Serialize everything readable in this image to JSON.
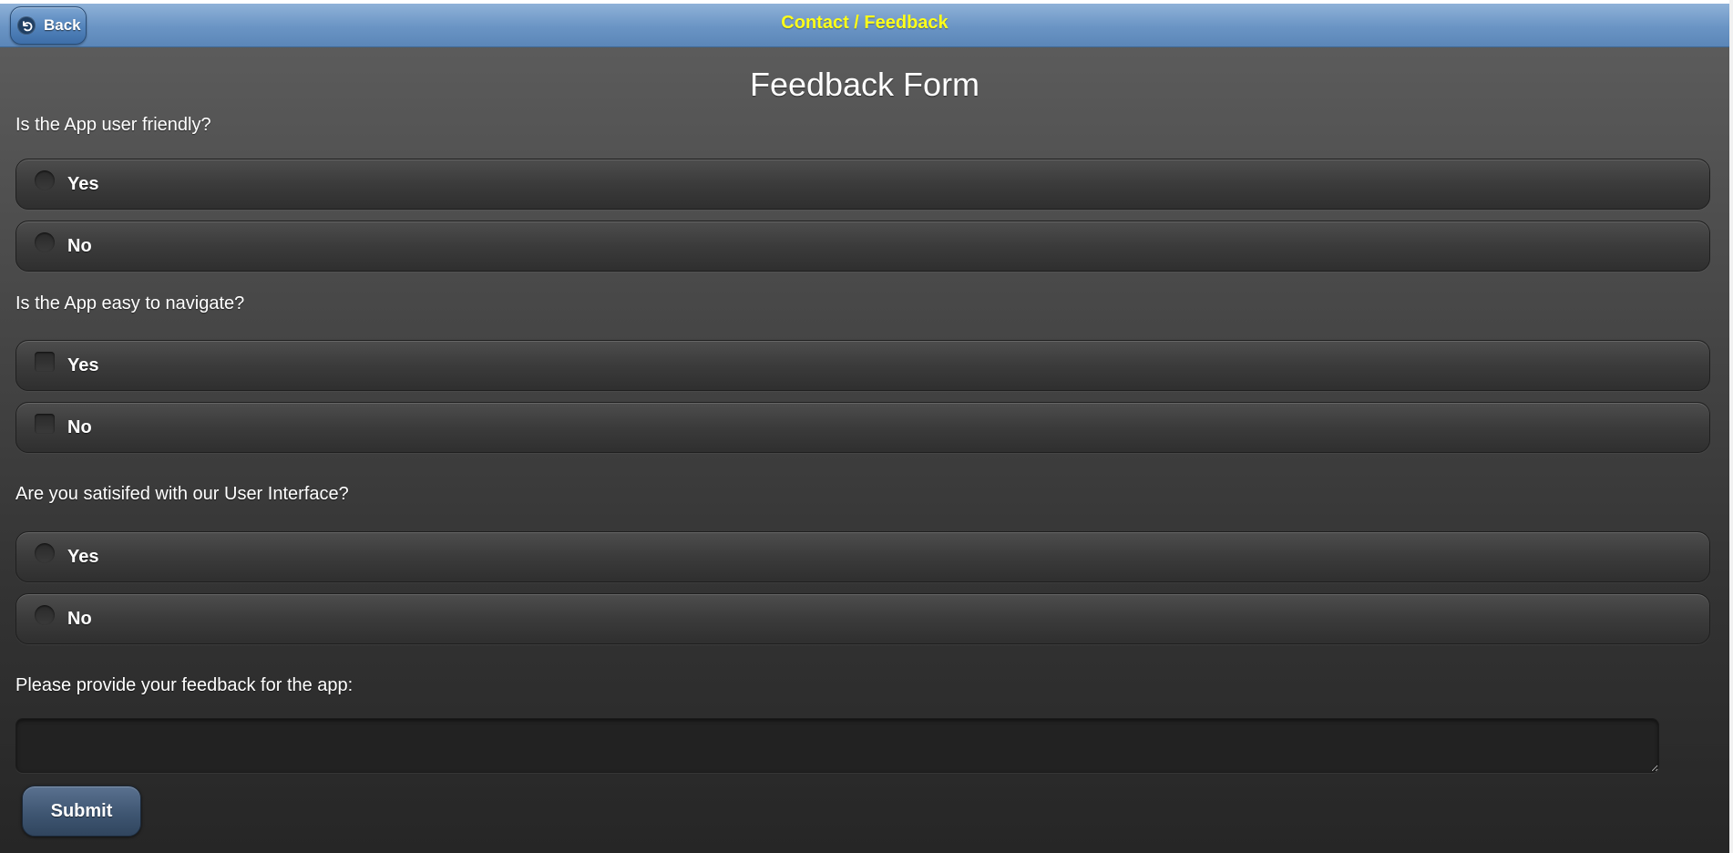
{
  "header": {
    "back_label": "Back",
    "title": "Contact / Feedback",
    "title_color": "#ffff1a",
    "bar_color": "#6a94c4"
  },
  "form": {
    "title": "Feedback Form",
    "questions": [
      {
        "text": "Is the App user friendly?",
        "input_type": "radio",
        "options": [
          {
            "label": "Yes",
            "selected": false
          },
          {
            "label": "No",
            "selected": false
          }
        ]
      },
      {
        "text": "Is the App easy to navigate?",
        "input_type": "checkbox",
        "options": [
          {
            "label": "Yes",
            "selected": false
          },
          {
            "label": "No",
            "selected": false
          }
        ]
      },
      {
        "text": "Are you satisifed with our User Interface?",
        "input_type": "radio",
        "options": [
          {
            "label": "Yes",
            "selected": false
          },
          {
            "label": "No",
            "selected": false
          }
        ]
      }
    ],
    "feedback_prompt": "Please provide your feedback for the app:",
    "feedback_value": "",
    "submit_label": "Submit"
  }
}
